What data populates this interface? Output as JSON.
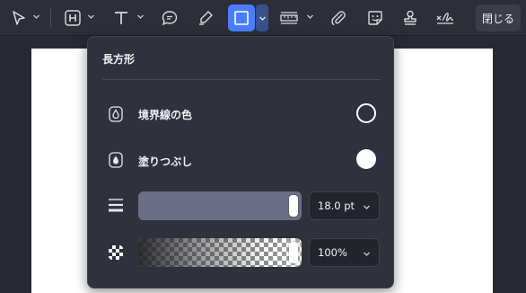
{
  "toolbar": {
    "close_label": "閉じる",
    "tools": [
      {
        "name": "select-tool",
        "icon": "cursor-arrow-icon"
      },
      {
        "name": "heading-tool",
        "icon": "heading-h-icon"
      },
      {
        "name": "text-tool",
        "icon": "text-t-icon"
      },
      {
        "name": "comment-tool",
        "icon": "speech-bubble-icon"
      },
      {
        "name": "highlighter-tool",
        "icon": "marker-pen-icon"
      },
      {
        "name": "rectangle-tool",
        "icon": "rectangle-icon",
        "active": true
      },
      {
        "name": "measure-tool",
        "icon": "ruler-icon"
      },
      {
        "name": "attachment-tool",
        "icon": "paperclip-icon"
      },
      {
        "name": "sticker-tool",
        "icon": "sticker-face-icon"
      },
      {
        "name": "stamp-tool",
        "icon": "stamp-icon"
      },
      {
        "name": "signature-tool",
        "icon": "signature-icon"
      }
    ]
  },
  "popup": {
    "title": "長方形",
    "border_color_label": "境界線の色",
    "fill_label": "塗りつぶし",
    "border_width": {
      "value": "18.0 pt",
      "level": 1.0
    },
    "opacity": {
      "value": "100%",
      "level": 1.0
    }
  },
  "colors": {
    "accent": "#4a7dff",
    "toolbar_bg": "#2c2f38",
    "popup_bg": "#2f323c",
    "page_bg": "#ffffff"
  }
}
